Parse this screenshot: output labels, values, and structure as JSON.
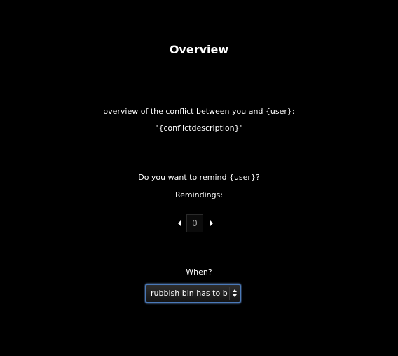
{
  "page": {
    "title": "Overview"
  },
  "conflict": {
    "heading": "overview of the conflict between you and {user}:",
    "description": "\"{conflictdescription}\""
  },
  "remind": {
    "question": "Do you want to remind {user}?",
    "label": "Remindings:",
    "count": "0"
  },
  "schedule": {
    "label": "When?",
    "selected_option": "rubbish bin has to be taken out"
  },
  "icons": {
    "decrement": "triangle-left-icon",
    "increment": "triangle-right-icon",
    "select_arrows": "up-down-arrows-icon"
  },
  "colors": {
    "background": "#000000",
    "text": "#ffffff",
    "focus_ring": "#4a79b8"
  }
}
